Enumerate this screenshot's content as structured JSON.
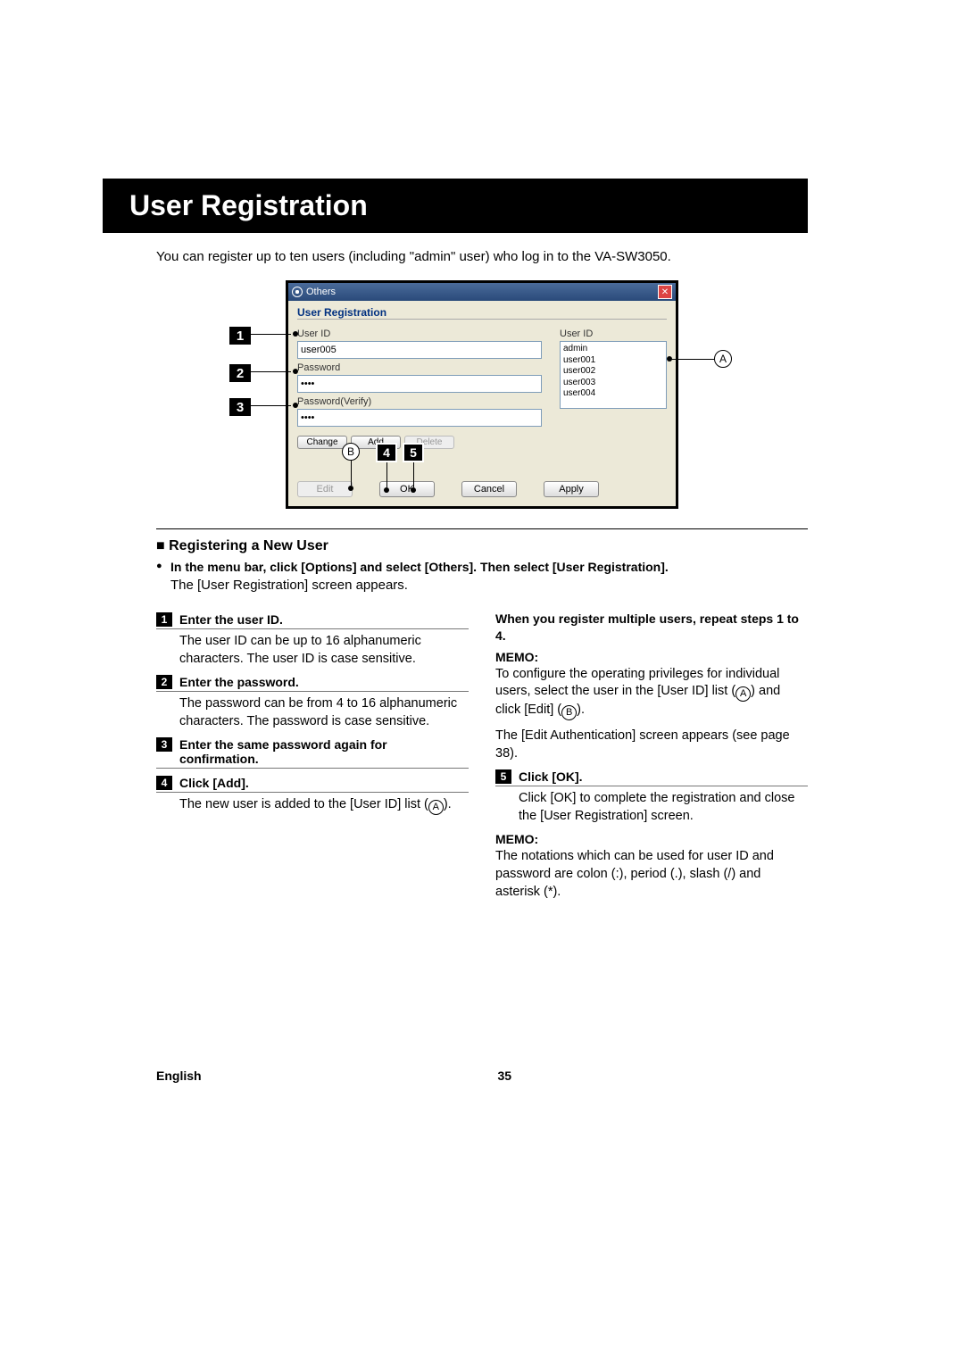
{
  "title": "User Registration",
  "intro": "You can register up to ten users (including \"admin\" user) who log in to the VA-SW3050.",
  "dialog": {
    "window_title": "Others",
    "heading": "User Registration",
    "labels": {
      "user_id_left": "User ID",
      "user_id_right": "User ID",
      "password": "Password",
      "password_verify": "Password(Verify)"
    },
    "inputs": {
      "user_id_value": "user005",
      "password_value": "****",
      "password_verify_value": "****"
    },
    "list_items": [
      "admin",
      "user001",
      "user002",
      "user003",
      "user004"
    ],
    "buttons": {
      "change": "Change",
      "add": "Add",
      "delete": "Delete",
      "edit": "Edit",
      "ok": "OK",
      "cancel": "Cancel",
      "apply": "Apply"
    }
  },
  "callouts": {
    "n1": "1",
    "n2": "2",
    "n3": "3",
    "n4": "4",
    "n5": "5",
    "A": "A",
    "B": "B"
  },
  "section": {
    "heading_prefix": "■",
    "heading": "Registering a New User",
    "menu_instruction": "In the menu bar, click [Options] and select [Others]. Then select [User Registration].",
    "menu_result": "The [User Registration] screen appears."
  },
  "steps_left": [
    {
      "num": "1",
      "title": "Enter the user ID.",
      "body": "The user ID can be up to 16 alphanumeric characters. The user ID is case sensitive."
    },
    {
      "num": "2",
      "title": "Enter the password.",
      "body": "The password can be from 4 to 16 alphanumeric characters. The password is case sensitive."
    },
    {
      "num": "3",
      "title": "Enter the same password again for confirmation.",
      "body": ""
    },
    {
      "num": "4",
      "title": "Click [Add].",
      "body_prefix": "The new user is added to the [User ID] list (",
      "body_letter": "A",
      "body_suffix": ")."
    }
  ],
  "right_col": {
    "repeat": "When you register multiple users, repeat steps 1 to 4.",
    "memo1_label": "MEMO:",
    "memo1_line1_pre": "To configure the operating privileges for individual users, select the user in the [User ID] list (",
    "memo1_line1_mid": ") and click [Edit] (",
    "memo1_line1_post": ").",
    "memo1_line2": "The [Edit Authentication] screen appears (see page 38).",
    "step5_num": "5",
    "step5_title": "Click [OK].",
    "step5_body": "Click [OK] to complete the registration and close the [User Registration] screen.",
    "memo2_label": "MEMO:",
    "memo2_body": "The notations which can be used for user ID and password are colon (:), period (.), slash (/) and asterisk (*)."
  },
  "footer": {
    "language": "English",
    "page": "35"
  }
}
